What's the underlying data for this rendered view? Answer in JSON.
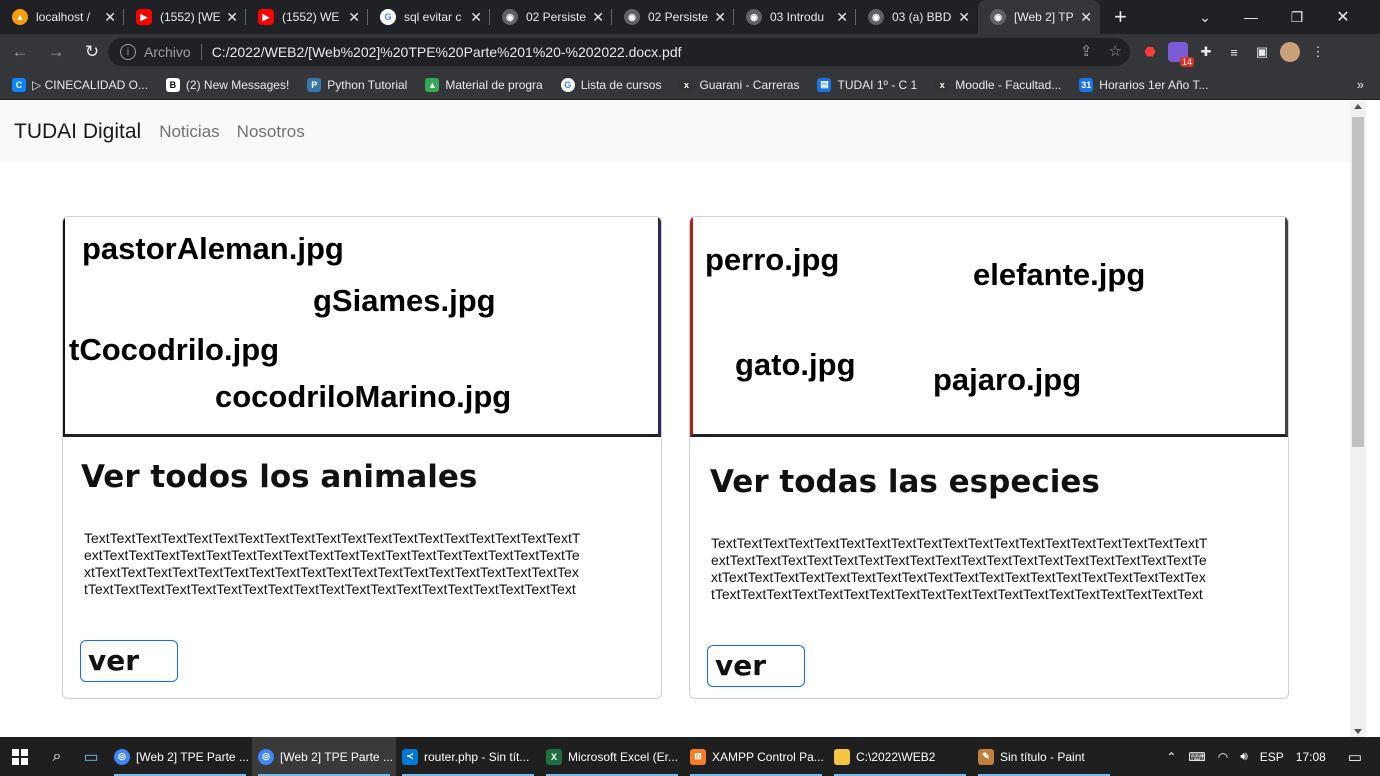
{
  "browser": {
    "tabs": [
      {
        "label": "localhost /",
        "icon": "phpmyadmin-icon",
        "color": "#f89c0e"
      },
      {
        "label": "(1552) [WE",
        "icon": "youtube-icon",
        "color": "#ff0000"
      },
      {
        "label": "(1552) WE",
        "icon": "youtube-icon",
        "color": "#ff0000"
      },
      {
        "label": "sql evitar c",
        "icon": "google-icon",
        "color": "#4285f4"
      },
      {
        "label": "02 Persiste",
        "icon": "globe-icon",
        "color": "#9aa0a6"
      },
      {
        "label": "02 Persiste",
        "icon": "globe-icon",
        "color": "#9aa0a6"
      },
      {
        "label": "03 Introdu",
        "icon": "globe-icon",
        "color": "#9aa0a6"
      },
      {
        "label": "03 (a) BBD",
        "icon": "globe-icon",
        "color": "#9aa0a6"
      },
      {
        "label": "[Web 2] TP",
        "icon": "globe-icon",
        "color": "#9aa0a6"
      }
    ],
    "address": {
      "protocol": "Archivo",
      "url": "C:/2022/WEB2/[Web%202]%20TPE%20Parte%201%20-%202022.docx.pdf"
    },
    "extension_badge": "14",
    "bookmarks": [
      {
        "label": "▷ CINECALIDAD O...",
        "icon": "c-icon",
        "color": "#0a84ff"
      },
      {
        "label": "(2) New Messages!",
        "icon": "b-icon",
        "color": "#444"
      },
      {
        "label": "Python Tutorial",
        "icon": "python-icon",
        "color": "#3776ab"
      },
      {
        "label": "Material de progra",
        "icon": "drive-icon",
        "color": "#34a853"
      },
      {
        "label": "Lista de cursos",
        "icon": "google-icon",
        "color": "#4285f4"
      },
      {
        "label": "Guarani - Carreras",
        "icon": "x-icon",
        "color": "#333"
      },
      {
        "label": "TUDAI 1º - C 1",
        "icon": "form-icon",
        "color": "#1a73e8"
      },
      {
        "label": "Moodle - Facultad...",
        "icon": "x-icon",
        "color": "#333"
      },
      {
        "label": "Horarios 1er Año T...",
        "icon": "calendar-icon",
        "color": "#1a73e8"
      }
    ]
  },
  "page": {
    "brand": "TUDAI Digital",
    "nav": [
      "Noticias",
      "Nosotros"
    ],
    "cards": [
      {
        "image_labels": [
          "pastorAleman.jpg",
          "gSiames.jpg",
          "tCocodrilo.jpg",
          "cocodriloMarino.jpg"
        ],
        "title": "Ver todos los animales",
        "text": "TextTextTextTextTextTextTextTextTextTextTextTextTextTextTextTextTextTextTextTextTextTextTextTextTextTextTextTextTextTextTextTextTextTextTextTextTextTextTextTextTextTextTextTextTextTextTextTextTextTextTextTextTextTextTextTextTextTextTextTextTextTextTextTextTextTextTextTextTextTextTextTextTextTextTextTextText",
        "button": "ver"
      },
      {
        "image_labels": [
          "perro.jpg",
          "elefante.jpg",
          "gato.jpg",
          "pajaro.jpg"
        ],
        "title": "Ver todas las especies",
        "text": "TextTextTextTextTextTextTextTextTextTextTextTextTextTextTextTextTextTextTextTextTextTextTextTextTextTextTextTextTextTextTextTextTextTextTextTextTextTextTextTextTextTextTextTextTextTextTextTextTextTextTextTextTextTextTextTextTextTextTextTextTextTextTextTextTextTextTextTextTextTextTextTextTextTextTextTextText",
        "button": "ver"
      }
    ]
  },
  "taskbar": {
    "tasks": [
      {
        "label": "[Web 2] TPE Parte ...",
        "icon": "chrome-icon",
        "color": "#4285f4",
        "active": false
      },
      {
        "label": "[Web 2] TPE Parte ...",
        "icon": "chrome-icon",
        "color": "#4285f4",
        "active": true
      },
      {
        "label": "router.php - Sin tít...",
        "icon": "vscode-icon",
        "color": "#0078d4",
        "active": false
      },
      {
        "label": "Microsoft Excel (Er...",
        "icon": "excel-icon",
        "color": "#1d6f42",
        "active": false
      },
      {
        "label": "XAMPP Control Pa...",
        "icon": "xampp-icon",
        "color": "#fb7a24",
        "active": false
      },
      {
        "label": "C:\\2022\\WEB2",
        "icon": "folder-icon",
        "color": "#f4c542",
        "active": false
      },
      {
        "label": "Sin título - Paint",
        "icon": "paint-icon",
        "color": "#c08040",
        "active": false
      }
    ],
    "lang": "ESP",
    "time": "17:08"
  }
}
